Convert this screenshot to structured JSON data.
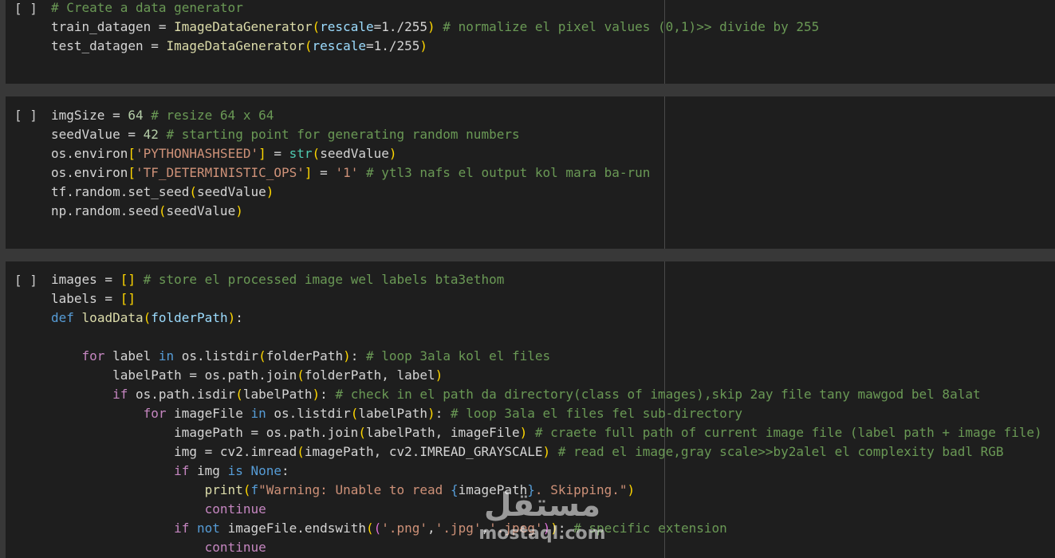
{
  "cells": [
    {
      "run_label": "[ ]",
      "lines": [
        [
          [
            "c",
            "# Create a data generator"
          ]
        ],
        [
          [
            "",
            "train_datagen = "
          ],
          [
            "fn",
            "ImageDataGenerator"
          ],
          [
            "p",
            "("
          ],
          [
            "v",
            "rescale"
          ],
          [
            "",
            "=1./255"
          ],
          [
            "p",
            ")"
          ],
          [
            "c",
            " # normalize el pixel values (0,1)>> divide by 255"
          ]
        ],
        [
          [
            "",
            "test_datagen = "
          ],
          [
            "fn",
            "ImageDataGenerator"
          ],
          [
            "p",
            "("
          ],
          [
            "v",
            "rescale"
          ],
          [
            "",
            "=1./255"
          ],
          [
            "p",
            ")"
          ]
        ]
      ]
    },
    {
      "run_label": "[ ]",
      "lines": [
        [
          [
            "",
            "imgSize = "
          ],
          [
            "n",
            "64"
          ],
          [
            "c",
            " # resize 64 x 64"
          ]
        ],
        [
          [
            "",
            "seedValue = "
          ],
          [
            "n",
            "42"
          ],
          [
            "c",
            " # starting point for generating random numbers"
          ]
        ],
        [
          [
            "",
            "os.environ"
          ],
          [
            "p",
            "["
          ],
          [
            "s",
            "'PYTHONHASHSEED'"
          ],
          [
            "p",
            "]"
          ],
          [
            "",
            " = "
          ],
          [
            "t",
            "str"
          ],
          [
            "p",
            "("
          ],
          [
            "",
            "seedValue"
          ],
          [
            "p",
            ")"
          ]
        ],
        [
          [
            "",
            "os.environ"
          ],
          [
            "p",
            "["
          ],
          [
            "s",
            "'TF_DETERMINISTIC_OPS'"
          ],
          [
            "p",
            "]"
          ],
          [
            "",
            " = "
          ],
          [
            "s",
            "'1'"
          ],
          [
            "c",
            " # ytl3 nafs el output kol mara ba-run"
          ]
        ],
        [
          [
            "",
            "tf.random.set_seed"
          ],
          [
            "p",
            "("
          ],
          [
            "",
            "seedValue"
          ],
          [
            "p",
            ")"
          ]
        ],
        [
          [
            "",
            "np.random.seed"
          ],
          [
            "p",
            "("
          ],
          [
            "",
            "seedValue"
          ],
          [
            "p",
            ")"
          ]
        ]
      ]
    },
    {
      "run_label": "[ ]",
      "lines": [
        [
          [
            "",
            "images = "
          ],
          [
            "p",
            "[]"
          ],
          [
            "c",
            " # store el processed image wel labels bta3ethom"
          ]
        ],
        [
          [
            "",
            "labels = "
          ],
          [
            "p",
            "[]"
          ]
        ],
        [
          [
            "k",
            "def"
          ],
          [
            "",
            " "
          ],
          [
            "fn",
            "loadData"
          ],
          [
            "p",
            "("
          ],
          [
            "v",
            "folderPath"
          ],
          [
            "p",
            ")"
          ],
          [
            "",
            ":"
          ]
        ],
        [
          [
            "",
            ""
          ]
        ],
        [
          [
            "",
            "    "
          ],
          [
            "kc",
            "for"
          ],
          [
            "",
            " label "
          ],
          [
            "k",
            "in"
          ],
          [
            "",
            " os.listdir"
          ],
          [
            "p",
            "("
          ],
          [
            "",
            "folderPath"
          ],
          [
            "p",
            ")"
          ],
          [
            "",
            ": "
          ],
          [
            "c",
            "# loop 3ala kol el files"
          ]
        ],
        [
          [
            "",
            "        labelPath = os.path.join"
          ],
          [
            "p",
            "("
          ],
          [
            "",
            "folderPath, label"
          ],
          [
            "p",
            ")"
          ]
        ],
        [
          [
            "",
            "        "
          ],
          [
            "kc",
            "if"
          ],
          [
            "",
            " os.path.isdir"
          ],
          [
            "p",
            "("
          ],
          [
            "",
            "labelPath"
          ],
          [
            "p",
            ")"
          ],
          [
            "",
            ": "
          ],
          [
            "c",
            "# check in el path da directory(class of images),skip 2ay file tany mawgod bel 8alat"
          ]
        ],
        [
          [
            "",
            "            "
          ],
          [
            "kc",
            "for"
          ],
          [
            "",
            " imageFile "
          ],
          [
            "k",
            "in"
          ],
          [
            "",
            " os.listdir"
          ],
          [
            "p",
            "("
          ],
          [
            "",
            "labelPath"
          ],
          [
            "p",
            ")"
          ],
          [
            "",
            ": "
          ],
          [
            "c",
            "# loop 3ala el files fel sub-directory"
          ]
        ],
        [
          [
            "",
            "                imagePath = os.path.join"
          ],
          [
            "p",
            "("
          ],
          [
            "",
            "labelPath, imageFile"
          ],
          [
            "p",
            ")"
          ],
          [
            "c",
            " # craete full path of current image file (label path + image file)"
          ]
        ],
        [
          [
            "",
            "                img = cv2.imread"
          ],
          [
            "p",
            "("
          ],
          [
            "",
            "imagePath, cv2.IMREAD_GRAYSCALE"
          ],
          [
            "p",
            ")"
          ],
          [
            "c",
            " # read el image,gray scale>>by2alel el complexity badl RGB"
          ]
        ],
        [
          [
            "",
            "                "
          ],
          [
            "kc",
            "if"
          ],
          [
            "",
            " img "
          ],
          [
            "k",
            "is"
          ],
          [
            "",
            " "
          ],
          [
            "k",
            "None"
          ],
          [
            "",
            ":"
          ]
        ],
        [
          [
            "",
            "                    "
          ],
          [
            "fn",
            "print"
          ],
          [
            "p",
            "("
          ],
          [
            "k",
            "f"
          ],
          [
            "s",
            "\"Warning: Unable to read "
          ],
          [
            "k",
            "{"
          ],
          [
            "",
            "imagePath"
          ],
          [
            "k",
            "}"
          ],
          [
            "s",
            ". Skipping.\""
          ],
          [
            "p",
            ")"
          ]
        ],
        [
          [
            "",
            "                    "
          ],
          [
            "kc",
            "continue"
          ]
        ],
        [
          [
            "",
            "                "
          ],
          [
            "kc",
            "if"
          ],
          [
            "",
            " "
          ],
          [
            "k",
            "not"
          ],
          [
            "",
            " imageFile.endswith"
          ],
          [
            "p",
            "("
          ],
          [
            "p2",
            "("
          ],
          [
            "s",
            "'.png'"
          ],
          [
            "",
            ","
          ],
          [
            "s",
            "'.jpg'"
          ],
          [
            "",
            ","
          ],
          [
            "s",
            "'.jpeg'"
          ],
          [
            "p2",
            ")"
          ],
          [
            "p",
            ")"
          ],
          [
            "",
            ": "
          ],
          [
            "c",
            "# specific extension"
          ]
        ],
        [
          [
            "",
            "                    "
          ],
          [
            "kc",
            "continue"
          ]
        ]
      ]
    }
  ],
  "watermark": {
    "arabic": "مستقل",
    "latin": "mostaql.com"
  }
}
